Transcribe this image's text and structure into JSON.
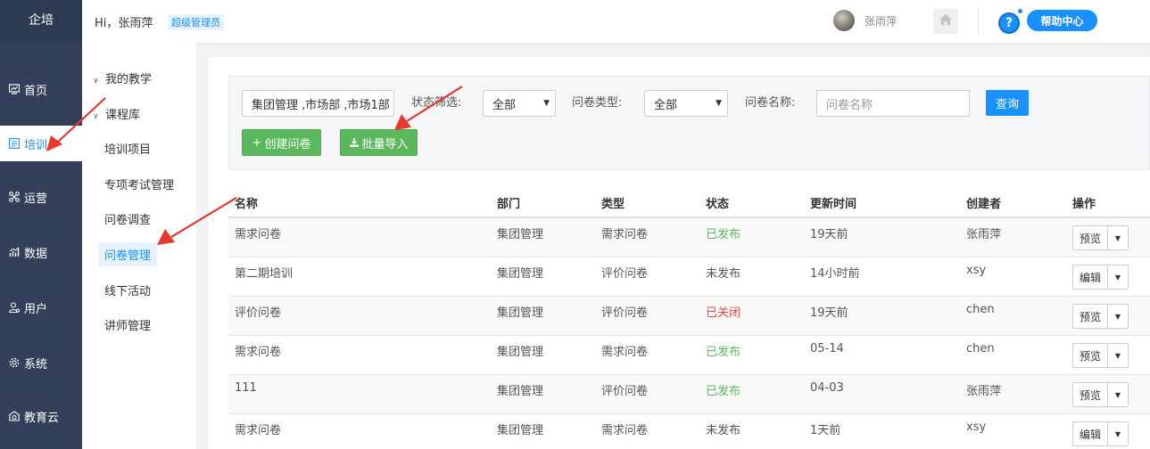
{
  "brand": "企培",
  "leftnav": [
    {
      "label": "首页",
      "icon": "dashboard-icon"
    },
    {
      "label": "培训",
      "icon": "training-icon",
      "active": true
    },
    {
      "label": "运营",
      "icon": "operations-icon"
    },
    {
      "label": "数据",
      "icon": "data-chart-icon"
    },
    {
      "label": "用户",
      "icon": "user-icon"
    },
    {
      "label": "系统",
      "icon": "gear-icon"
    },
    {
      "label": "教育云",
      "icon": "cloud-icon"
    }
  ],
  "header": {
    "greeting": "Hi，张雨萍",
    "role_badge": "超级管理员",
    "username": "张雨萍",
    "help_label": "帮助中心",
    "help_glyph": "?"
  },
  "submenu": {
    "group_my_teaching": "我的教学",
    "group_course_library": "课程库",
    "items": [
      "培训项目",
      "专项考试管理",
      "问卷调查",
      "问卷管理",
      "线下活动",
      "讲师管理"
    ],
    "active_index": 3
  },
  "filters": {
    "department_value": "集团管理 ,市场部 ,市场1部",
    "status_label": "状态筛选:",
    "status_value": "全部",
    "type_label": "问卷类型:",
    "type_value": "全部",
    "name_label": "问卷名称:",
    "name_placeholder": "问卷名称",
    "query_button": "查询",
    "create_button": "创建问卷",
    "create_glyph": "+",
    "import_button": "批量导入"
  },
  "table": {
    "columns": [
      "名称",
      "部门",
      "类型",
      "状态",
      "更新时间",
      "创建者",
      "操作"
    ],
    "rows": [
      {
        "name": "需求问卷",
        "dept": "集团管理",
        "type": "需求问卷",
        "status": "已发布",
        "status_kind": "published",
        "updated": "19天前",
        "creator": "张雨萍",
        "action": "预览"
      },
      {
        "name": "第二期培训",
        "dept": "集团管理",
        "type": "评价问卷",
        "status": "未发布",
        "status_kind": "unpublished",
        "updated": "14小时前",
        "creator": "xsy",
        "action": "编辑"
      },
      {
        "name": "评价问卷",
        "dept": "集团管理",
        "type": "评价问卷",
        "status": "已关闭",
        "status_kind": "closed",
        "updated": "19天前",
        "creator": "chen",
        "action": "预览"
      },
      {
        "name": "需求问卷",
        "dept": "集团管理",
        "type": "需求问卷",
        "status": "已发布",
        "status_kind": "published",
        "updated": "05-14",
        "creator": "chen",
        "action": "预览"
      },
      {
        "name": "111",
        "dept": "集团管理",
        "type": "评价问卷",
        "status": "已发布",
        "status_kind": "published",
        "updated": "04-03",
        "creator": "张雨萍",
        "action": "预览"
      },
      {
        "name": "需求问卷",
        "dept": "集团管理",
        "type": "需求问卷",
        "status": "未发布",
        "status_kind": "unpublished",
        "updated": "1天前",
        "creator": "xsy",
        "action": "编辑"
      }
    ]
  },
  "colors": {
    "nav_bg": "#34405a",
    "accent": "#1890ff",
    "green": "#5cb85c",
    "closed_red": "#e24b4b",
    "arrow_red": "#e8392f"
  }
}
